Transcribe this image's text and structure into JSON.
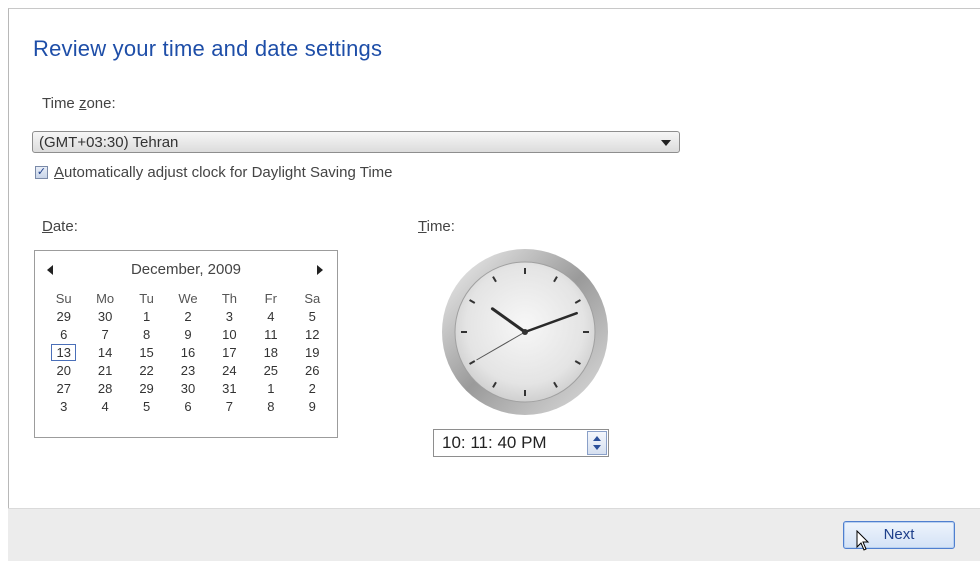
{
  "page": {
    "title": "Review your time and date settings"
  },
  "timezone": {
    "label_prefix": "Time ",
    "label_underlined": "z",
    "label_suffix": "one:",
    "selected_value": "(GMT+03:30) Tehran"
  },
  "dst": {
    "checked": true,
    "label_underlined": "A",
    "label_rest": "utomatically adjust clock for Daylight Saving Time"
  },
  "date": {
    "label_underlined": "D",
    "label_rest": "ate:"
  },
  "time": {
    "label_underlined": "T",
    "label_rest": "ime:",
    "value": "10: 11: 40 PM",
    "clock_hour": 10,
    "clock_minute": 11,
    "clock_second": 40
  },
  "calendar": {
    "month_title": "December, 2009",
    "weekdays": [
      "Su",
      "Mo",
      "Tu",
      "We",
      "Th",
      "Fr",
      "Sa"
    ],
    "weeks": [
      [
        "29",
        "30",
        "1",
        "2",
        "3",
        "4",
        "5"
      ],
      [
        "6",
        "7",
        "8",
        "9",
        "10",
        "11",
        "12"
      ],
      [
        "13",
        "14",
        "15",
        "16",
        "17",
        "18",
        "19"
      ],
      [
        "20",
        "21",
        "22",
        "23",
        "24",
        "25",
        "26"
      ],
      [
        "27",
        "28",
        "29",
        "30",
        "31",
        "1",
        "2"
      ],
      [
        "3",
        "4",
        "5",
        "6",
        "7",
        "8",
        "9"
      ]
    ],
    "selected_day": "13"
  },
  "footer": {
    "next_label": "Next"
  },
  "colors": {
    "title": "#1e4ea8",
    "footer_bg": "#ececec",
    "button_border": "#4f7fcf"
  },
  "icons": {
    "dropdown": "chevron-down-icon",
    "prev_month": "chevron-left-icon",
    "next_month": "chevron-right-icon",
    "spinner_up": "arrow-up-icon",
    "spinner_down": "arrow-down-icon",
    "cursor": "mouse-pointer-icon"
  }
}
